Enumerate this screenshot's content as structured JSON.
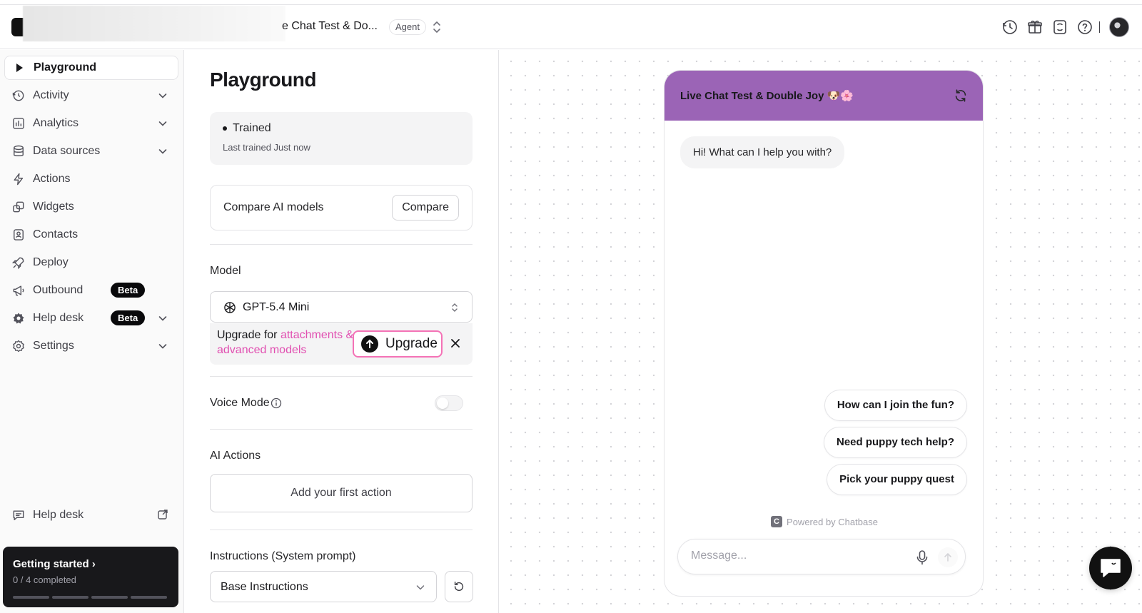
{
  "header": {
    "agent_title": "e Chat Test & Do...",
    "agent_badge": "Agent",
    "icons": [
      "history-icon",
      "gift-icon",
      "changelog-icon",
      "help-icon"
    ]
  },
  "sidebar": {
    "items": [
      {
        "label": "Playground",
        "icon": "play-icon",
        "active": true,
        "chevron": false
      },
      {
        "label": "Activity",
        "icon": "history-icon",
        "chevron": true
      },
      {
        "label": "Analytics",
        "icon": "chart-icon",
        "chevron": true
      },
      {
        "label": "Data sources",
        "icon": "database-icon",
        "chevron": true
      },
      {
        "label": "Actions",
        "icon": "bolt-icon",
        "chevron": false
      },
      {
        "label": "Widgets",
        "icon": "widgets-icon",
        "chevron": false
      },
      {
        "label": "Contacts",
        "icon": "contacts-icon",
        "chevron": false
      },
      {
        "label": "Deploy",
        "icon": "rocket-icon",
        "chevron": false
      },
      {
        "label": "Outbound",
        "icon": "megaphone-icon",
        "badge": "Beta",
        "chevron": false
      },
      {
        "label": "Help desk",
        "icon": "helpdesk-icon",
        "badge": "Beta",
        "chevron": true
      },
      {
        "label": "Settings",
        "icon": "settings-icon",
        "chevron": true
      }
    ],
    "footer_link": "Help desk",
    "getting_started": {
      "title": "Getting started",
      "progress_text": "0 / 4 completed",
      "completed": 0,
      "total": 4
    }
  },
  "panel": {
    "title": "Playground",
    "status": "Trained",
    "last_trained": "Last trained Just now",
    "compare_label": "Compare AI models",
    "compare_button": "Compare",
    "model_label": "Model",
    "model_value": "GPT-5.4 Mini",
    "upgrade_prefix": "Upgrade for ",
    "upgrade_link": "attachments & advanced models",
    "upgrade_button": "Upgrade",
    "voice_mode_label": "Voice Mode",
    "voice_mode_enabled": false,
    "ai_actions_label": "AI Actions",
    "add_action_button": "Add your first action",
    "instructions_label": "Instructions (System prompt)",
    "instructions_value": "Base Instructions"
  },
  "chat": {
    "title": "Live Chat Test & Double Joy 🐶🌸",
    "header_color": "#9b64b6",
    "greeting": "Hi! What can I help you with?",
    "suggestions": [
      "How can I join the fun?",
      "Need puppy tech help?",
      "Pick your puppy quest"
    ],
    "powered_by": "Powered by Chatbase",
    "input_placeholder": "Message..."
  },
  "colors": {
    "accent_pink": "#e14fb1",
    "dark": "#18181b"
  }
}
